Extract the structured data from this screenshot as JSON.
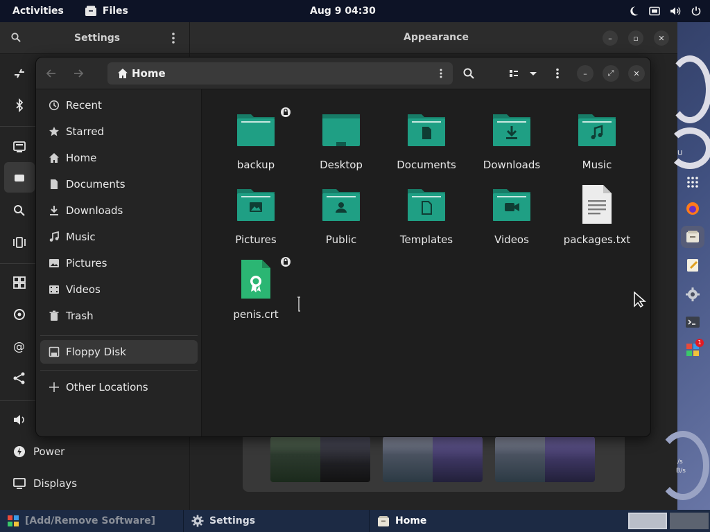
{
  "topbar": {
    "activities": "Activities",
    "app_name": "Files",
    "clock": "Aug 9  04:30"
  },
  "settings": {
    "title": "Settings",
    "panel_title": "Appearance",
    "sidebar_labels": {
      "power": "Power",
      "displays": "Displays"
    }
  },
  "files": {
    "path": "Home",
    "sidebar": [
      {
        "label": "Recent",
        "icon": "clock-icon"
      },
      {
        "label": "Starred",
        "icon": "star-icon"
      },
      {
        "label": "Home",
        "icon": "home-icon"
      },
      {
        "label": "Documents",
        "icon": "document-icon"
      },
      {
        "label": "Downloads",
        "icon": "download-icon"
      },
      {
        "label": "Music",
        "icon": "music-icon"
      },
      {
        "label": "Pictures",
        "icon": "picture-icon"
      },
      {
        "label": "Videos",
        "icon": "video-icon"
      },
      {
        "label": "Trash",
        "icon": "trash-icon"
      },
      {
        "label": "Floppy Disk",
        "icon": "floppy-icon"
      },
      {
        "label": "Other Locations",
        "icon": "plus-icon"
      }
    ],
    "items": [
      {
        "name": "backup",
        "type": "folder",
        "icon": "folder-icon",
        "locked": true
      },
      {
        "name": "Desktop",
        "type": "folder",
        "icon": "desktop-folder-icon"
      },
      {
        "name": "Documents",
        "type": "folder",
        "icon": "documents-folder-icon"
      },
      {
        "name": "Downloads",
        "type": "folder",
        "icon": "downloads-folder-icon"
      },
      {
        "name": "Music",
        "type": "folder",
        "icon": "music-folder-icon"
      },
      {
        "name": "Pictures",
        "type": "folder",
        "icon": "pictures-folder-icon"
      },
      {
        "name": "Public",
        "type": "folder",
        "icon": "public-folder-icon"
      },
      {
        "name": "Templates",
        "type": "folder",
        "icon": "templates-folder-icon"
      },
      {
        "name": "Videos",
        "type": "folder",
        "icon": "videos-folder-icon"
      },
      {
        "name": "packages.txt",
        "type": "text",
        "icon": "text-file-icon"
      },
      {
        "name": "penis.crt",
        "type": "certificate",
        "icon": "certificate-file-icon",
        "locked": true
      }
    ]
  },
  "taskbar": {
    "items": [
      {
        "label": "[Add/Remove Software]",
        "icon": "software-icon"
      },
      {
        "label": "Settings",
        "icon": "gear-icon"
      },
      {
        "label": "Home",
        "icon": "files-icon"
      }
    ]
  },
  "dock": {
    "labels": [
      "U",
      "/s",
      "B/s"
    ],
    "badge": "1"
  },
  "colors": {
    "folder": "#1f9f84",
    "folder_dark": "#177c67",
    "panel_bg": "#1e1e1e",
    "sidebar_bg": "#242424"
  }
}
